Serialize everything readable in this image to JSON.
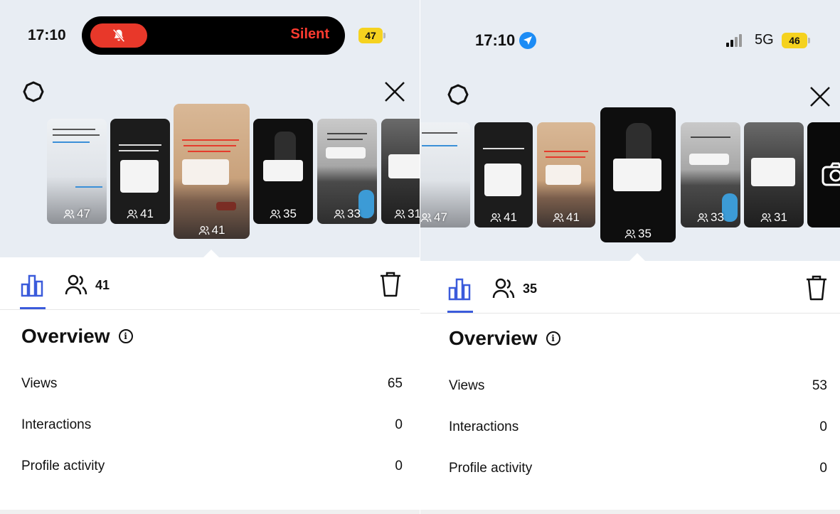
{
  "colors": {
    "accent": "#3b5bdb",
    "silent_red": "#ff3b30",
    "battery_yellow": "#f5d21f",
    "location_blue": "#1c8cf5",
    "header_bg": "#e8edf3"
  },
  "left": {
    "status": {
      "time": "17:10",
      "silent_label": "Silent",
      "battery": "47"
    },
    "stories": [
      {
        "count": "47",
        "theme": "light"
      },
      {
        "count": "41",
        "theme": "dark"
      },
      {
        "count": "41",
        "theme": "sepia",
        "selected": true
      },
      {
        "count": "35",
        "theme": "dark"
      },
      {
        "count": "33",
        "theme": "gray"
      },
      {
        "count": "31",
        "theme": "bw"
      }
    ],
    "viewers_count": "41",
    "overview": {
      "title": "Overview",
      "metrics": [
        {
          "label": "Views",
          "value": "65"
        },
        {
          "label": "Interactions",
          "value": "0"
        },
        {
          "label": "Profile activity",
          "value": "0"
        }
      ]
    }
  },
  "right": {
    "status": {
      "time": "17:10",
      "network": "5G",
      "battery": "46"
    },
    "stories": [
      {
        "count": "47",
        "theme": "light"
      },
      {
        "count": "41",
        "theme": "dark"
      },
      {
        "count": "41",
        "theme": "sepia"
      },
      {
        "count": "35",
        "theme": "dark",
        "selected": true
      },
      {
        "count": "33",
        "theme": "gray"
      },
      {
        "count": "31",
        "theme": "bw"
      },
      {
        "count": "",
        "theme": "camera"
      }
    ],
    "viewers_count": "35",
    "overview": {
      "title": "Overview",
      "metrics": [
        {
          "label": "Views",
          "value": "53"
        },
        {
          "label": "Interactions",
          "value": "0"
        },
        {
          "label": "Profile activity",
          "value": "0"
        }
      ]
    }
  }
}
